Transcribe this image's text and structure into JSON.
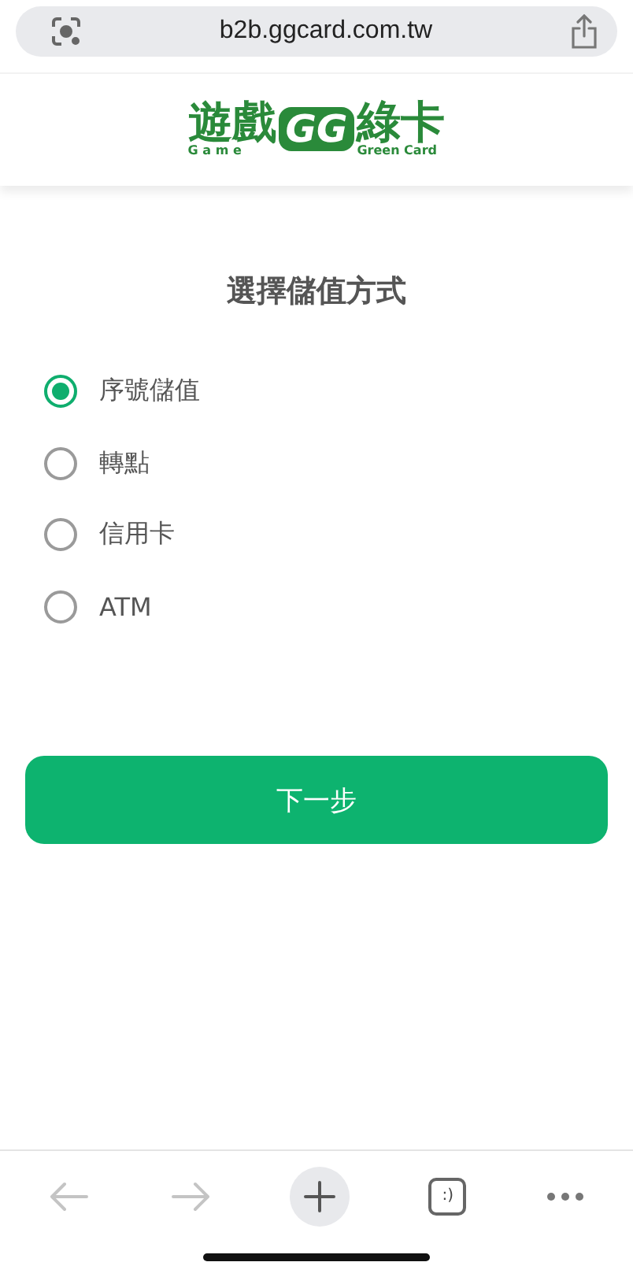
{
  "browser": {
    "url": "b2b.ggcard.com.tw"
  },
  "logo": {
    "left_word": "遊戲",
    "badge": "GG",
    "right_word": "綠卡",
    "left_caption": "G a m e",
    "right_caption": "Green Card"
  },
  "title": "選擇儲值方式",
  "options": [
    {
      "label": "序號儲值",
      "selected": true
    },
    {
      "label": "轉點",
      "selected": false
    },
    {
      "label": "信用卡",
      "selected": false
    },
    {
      "label": "ATM",
      "selected": false
    }
  ],
  "next_button": "下一步",
  "toolbar": {
    "back_disabled": true,
    "forward_disabled": true,
    "tabs_label": ":)"
  }
}
